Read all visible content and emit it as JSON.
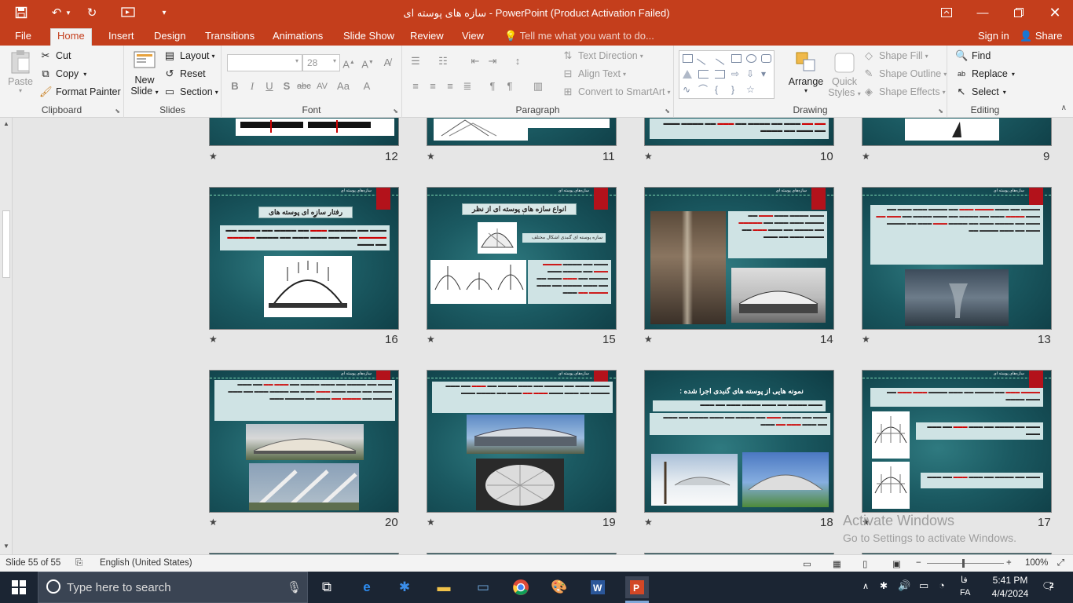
{
  "window": {
    "title": "سازه های پوسته ای - PowerPoint (Product Activation Failed)",
    "sign_in": "Sign in",
    "share": "Share"
  },
  "tabs": [
    "File",
    "Home",
    "Insert",
    "Design",
    "Transitions",
    "Animations",
    "Slide Show",
    "Review",
    "View"
  ],
  "tell_me": "Tell me what you want to do...",
  "ribbon": {
    "clipboard": {
      "label": "Clipboard",
      "paste": "Paste",
      "cut": "Cut",
      "copy": "Copy",
      "format_painter": "Format Painter"
    },
    "slides": {
      "label": "Slides",
      "new_slide_1": "New",
      "new_slide_2": "Slide",
      "layout": "Layout",
      "reset": "Reset",
      "section": "Section"
    },
    "font": {
      "label": "Font",
      "font_name": "",
      "font_size": "28"
    },
    "paragraph": {
      "label": "Paragraph",
      "text_direction": "Text Direction",
      "align_text": "Align Text",
      "smartart": "Convert to SmartArt"
    },
    "drawing": {
      "label": "Drawing",
      "arrange": "Arrange",
      "quick_styles_1": "Quick",
      "quick_styles_2": "Styles",
      "shape_fill": "Shape Fill",
      "shape_outline": "Shape Outline",
      "shape_effects": "Shape Effects"
    },
    "editing": {
      "label": "Editing",
      "find": "Find",
      "replace": "Replace",
      "select": "Select"
    }
  },
  "slides": [
    {
      "num": "12"
    },
    {
      "num": "11"
    },
    {
      "num": "10"
    },
    {
      "num": "9"
    },
    {
      "num": "16",
      "title": "رفتار سازه ای پوسته های گنبدی :"
    },
    {
      "num": "15",
      "title": "انواع سازه های پوسته ای از نظر فرم",
      "caption": "سازه پوسته ای گنبدی اشکال مختلف هندسی"
    },
    {
      "num": "14"
    },
    {
      "num": "13"
    },
    {
      "num": "20"
    },
    {
      "num": "19"
    },
    {
      "num": "18",
      "title": "نمونه هایی از پوسته های گنبدی اجرا شده :"
    },
    {
      "num": "17"
    }
  ],
  "header_tag": "سازه‌های پوسته ای",
  "watermark": {
    "line1": "Activate Windows",
    "line2": "Go to Settings to activate Windows."
  },
  "status": {
    "slide_info": "Slide 55 of 55",
    "language": "English (United States)",
    "zoom": "100%"
  },
  "taskbar": {
    "search_placeholder": "Type here to search",
    "time": "5:41 PM",
    "date": "4/4/2024",
    "lang": "FA",
    "lang2": "فا",
    "notifications": "2"
  }
}
